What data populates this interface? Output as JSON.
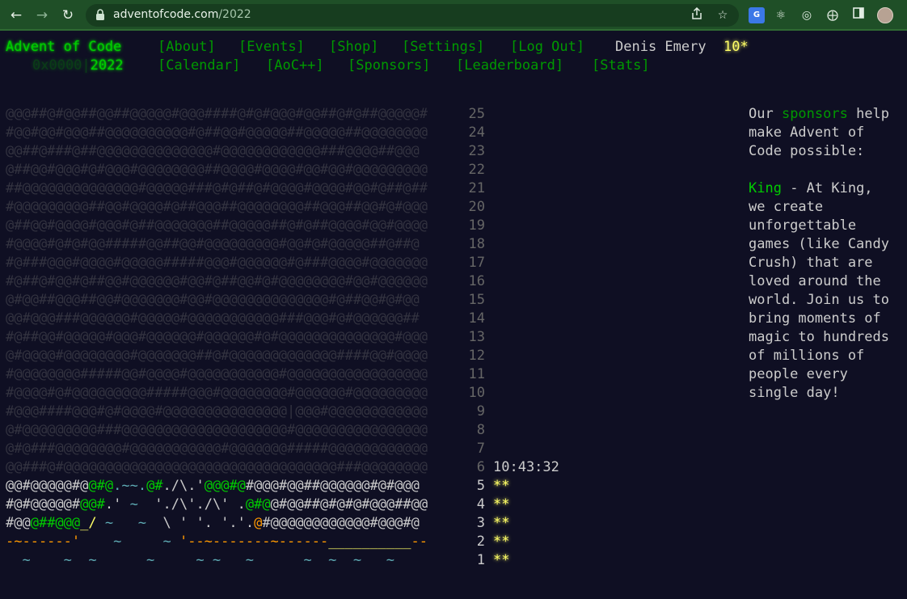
{
  "browser": {
    "url_domain": "adventofcode.com",
    "url_path": "/2022"
  },
  "site": {
    "title": "Advent of Code",
    "year_prefix": "0x0000|",
    "year": "2022",
    "nav_row1": [
      "[About]",
      "[Events]",
      "[Shop]",
      "[Settings]",
      "[Log Out]"
    ],
    "nav_row2": [
      "[Calendar]",
      "[AoC++]",
      "[Sponsors]",
      "[Leaderboard]",
      "[Stats]"
    ],
    "user_name": "Denis Emery",
    "user_stars": "10*"
  },
  "calendar": {
    "locked_rows": [
      {
        "art": "@@@##@#@@##@@##@@@@@#@@@####@#@#@@@#@@##@#@##@@@@@#",
        "day": "25"
      },
      {
        "art": "#@@#@@#@@@##@@@@@@@@@@#@##@@#@@@@@##@@@@@##@@@@@@@@",
        "day": "24"
      },
      {
        "art": "@@##@###@##@@@@@@@@@@@@@@#@@@@@@@@@@@@###@@@@##@@@",
        "day": "23"
      },
      {
        "art": "@##@@#@@@#@#@@@#@@@@@@@@##@@@@#@@@@#@@#@@#@@@@@@@@@",
        "day": "22"
      },
      {
        "art": "##@@@@@@@@@@@@@@#@@@@@###@#@##@#@@@@#@@@@#@@#@##@##",
        "day": "21"
      },
      {
        "art": "#@@@@@@@@@##@@#@@@@#@##@@@##@@@@@@@@##@@@##@@#@#@@@",
        "day": "20"
      },
      {
        "art": "@##@@#@@@@#@@@#@##@@@@@@@##@@@@@##@#@##@@@@#@@#@@@@",
        "day": "19"
      },
      {
        "art": "#@@@@#@#@#@@#####@@##@@#@@@@@@@@@#@@#@#@@@@@##@##@",
        "day": "18"
      },
      {
        "art": "#@###@@@#@@@@#@@@@@#####@@@#@@@@@@#@###@@@@#@@@@@@@",
        "day": "17"
      },
      {
        "art": "#@##@#@@#@##@@#@@@@@@#@@#@##@@#@#@@@@@@@@#@@#@@@@@@",
        "day": "16"
      },
      {
        "art": "@#@@##@@@##@@#@@@@@@@#@@#@@@@@@@@@@@@@@#@##@@#@#@@",
        "day": "15"
      },
      {
        "art": "@@#@@@###@@@@@@#@@@@@#@@@@@@@@@@@###@@@#@#@@@@@@##",
        "day": "14"
      },
      {
        "art": "#@##@@#@@@@@#@@@#@@@@@@#@@@@@@#@#@@@@@@@@@@@@@@#@@@",
        "day": "13"
      },
      {
        "art": "@#@@@@#@@@@@@@@#@@@@@@@##@#@@@@@@@@@@@@@####@@#@@@@",
        "day": "12"
      },
      {
        "art": "#@@@@@@@@#####@@#@@@@#@@@@@@@@@@@#@@@@@@@@@@@@@@@@@",
        "day": "11"
      },
      {
        "art": "#@@@@#@#@@@@@@@@@#####@@@#@@@@@@@@#@@@@@@#@@@@@@@@@",
        "day": "10"
      },
      {
        "art": "#@@@####@@@#@#@@@@#@@@@@@@@@@@@@@@|@@@#@@@@@@@@@@@@",
        "day": "9"
      },
      {
        "art": "@#@@@@@@@@@###@@@@@@@@@@@@@@@@@@@@#@@@@@@@@@@@@@@@@",
        "day": "8"
      },
      {
        "art": "@#@###@@@@@@@@#@@@@@@@@@@@#@@@@@@@#####@@@@@@@@@@@@",
        "day": "7"
      },
      {
        "art": "@@###@#@@@@@@@@@@@@@@@@@@@@@@@@@@@@@@@@@###@@@@@@@@",
        "day": "6"
      }
    ],
    "countdown": "10:43:32",
    "open_rows": [
      {
        "day": "5",
        "stars": "**",
        "segments": [
          {
            "text": "@@#@@@@@#@",
            "color": "#cccccc"
          },
          {
            "text": "@#@",
            "color": "#00cc00"
          },
          {
            "text": ".",
            "color": "#5eabb4"
          },
          {
            "text": "~~",
            "color": "#5eabb4"
          },
          {
            "text": ".",
            "color": "#5eabb4"
          },
          {
            "text": "@#",
            "color": "#00cc00"
          },
          {
            "text": "./\\.'",
            "color": "#cccccc"
          },
          {
            "text": "@@@#@",
            "color": "#00cc00"
          },
          {
            "text": "#@@@#@@##@@@@@@#@#@@@",
            "color": "#cccccc"
          }
        ]
      },
      {
        "day": "4",
        "stars": "**",
        "segments": [
          {
            "text": "#@#@@@@@#",
            "color": "#cccccc"
          },
          {
            "text": "@",
            "color": "#00cc00"
          },
          {
            "text": "@#",
            "color": "#00cc00"
          },
          {
            "text": ".' ",
            "color": "#cccccc"
          },
          {
            "text": "~",
            "color": "#5eabb4"
          },
          {
            "text": "  './\\'./\\' .",
            "color": "#cccccc"
          },
          {
            "text": "@#@",
            "color": "#00cc00"
          },
          {
            "text": "@#@@##@#@#@#@@@##@@",
            "color": "#cccccc"
          }
        ]
      },
      {
        "day": "3",
        "stars": "**",
        "segments": [
          {
            "text": "#@@",
            "color": "#cccccc"
          },
          {
            "text": "@##@@@",
            "color": "#00cc00"
          },
          {
            "text": "_/ ",
            "color": "#ffff66"
          },
          {
            "text": "~   ~",
            "color": "#5eabb4"
          },
          {
            "text": "  \\ ' '. '.'.",
            "color": "#cccccc"
          },
          {
            "text": "@",
            "color": "#ff9900"
          },
          {
            "text": "#@@@@@@@@@@@@#@@@#@",
            "color": "#cccccc"
          }
        ]
      },
      {
        "day": "2",
        "stars": "**",
        "segments": [
          {
            "text": "-~------'",
            "color": "#ff9900"
          },
          {
            "text": "    ~     ~ ",
            "color": "#5eabb4"
          },
          {
            "text": "'--~-------~------",
            "color": "#ff9900"
          },
          {
            "text": "__________",
            "color": "#ffff66"
          },
          {
            "text": "--",
            "color": "#ff9900"
          }
        ]
      },
      {
        "day": "1",
        "stars": "**",
        "segments": [
          {
            "text": "  ~    ~  ~      ~     ~ ~   ~      ~  ~  ~   ~  ",
            "color": "#5eabb4"
          }
        ]
      }
    ]
  },
  "sponsor_box": {
    "intro_before": "Our ",
    "intro_link": "sponsors",
    "intro_after_lines": [
      " help",
      "make Advent of",
      "Code possible:"
    ],
    "sponsor_name": "King",
    "sponsor_lines": [
      " - At King,",
      "we create",
      "unforgettable",
      "games (like Candy",
      "Crush) that are",
      "loved around the",
      "world. Join us to",
      "bring moments of",
      "magic to hundreds",
      "of millions of",
      "people every",
      "single day!"
    ]
  }
}
